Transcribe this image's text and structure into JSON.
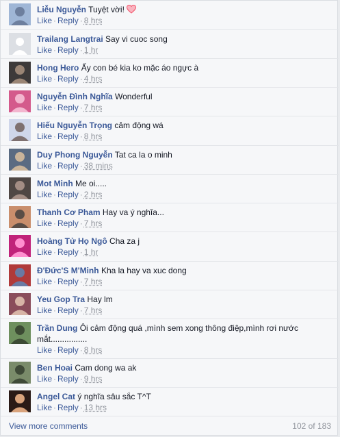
{
  "actions": {
    "like": "Like",
    "reply": "Reply"
  },
  "comments": [
    {
      "author": "Liễu Nguyễn",
      "text": "Tuyệt vời! ",
      "time": "8 hrs",
      "has_heart": true,
      "avatar": "avatar-photo"
    },
    {
      "author": "Trailang Langtrai",
      "text": "Say vi cuoc song",
      "time": "1 hr",
      "avatar": "default-avatar"
    },
    {
      "author": "Hong Hero",
      "text": "Ấy con bé kia ko mặc áo ngực à",
      "time": "4 hrs",
      "avatar": "avatar-photo"
    },
    {
      "author": "Nguyễn Đình Nghĩa",
      "text": "Wonderful",
      "time": "7 hrs",
      "avatar": "avatar-photo"
    },
    {
      "author": "Hiếu Nguyễn Trọng",
      "text": "cảm động wá",
      "time": "8 hrs",
      "avatar": "avatar-photo"
    },
    {
      "author": "Duy Phong Nguyễn",
      "text": "Tat ca la o minh",
      "time": "38 mins",
      "avatar": "avatar-photo"
    },
    {
      "author": "Mot Minh",
      "text": "Me oi.....",
      "time": "2 hrs",
      "avatar": "avatar-photo"
    },
    {
      "author": "Thanh Cơ Pham",
      "text": "Hay va ý nghĩa...",
      "time": "7 hrs",
      "avatar": "avatar-photo"
    },
    {
      "author": "Hoàng Tử Họ Ngô",
      "text": "Cha za j",
      "time": "1 hr",
      "avatar": "avatar-photo"
    },
    {
      "author": "Đ'Đức'S M'Minh",
      "text": "Kha la hay va xuc dong",
      "time": "7 hrs",
      "avatar": "avatar-photo"
    },
    {
      "author": "Yeu Gop Tra",
      "text": "Hay lm",
      "time": "7 hrs",
      "avatar": "avatar-photo"
    },
    {
      "author": "Trần Dung",
      "text": "Ôi cảm động quá ,mình sem xong thông điệp,mình rơi nước mắt................",
      "time": "8 hrs",
      "avatar": "avatar-photo"
    },
    {
      "author": "Ben Hoai",
      "text": "Cam dong wa ak",
      "time": "9 hrs",
      "avatar": "avatar-photo"
    },
    {
      "author": "Angel Cat",
      "text": "ý nghĩa sâu sắc T^T",
      "time": "13 hrs",
      "avatar": "avatar-photo"
    }
  ],
  "footer": {
    "view_more": "View more comments",
    "count": "102 of 183"
  },
  "colors": {
    "link": "#3b5998",
    "muted": "#90949c",
    "text": "#141823",
    "heart": "#f25268"
  }
}
